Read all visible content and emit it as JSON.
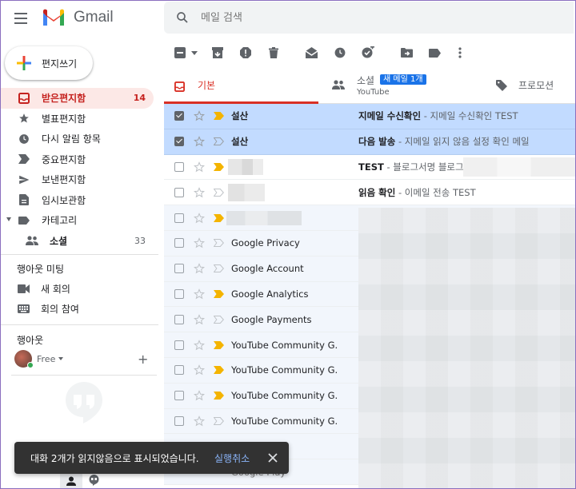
{
  "header": {
    "app_name": "Gmail",
    "search_placeholder": "메일 검색"
  },
  "compose_label": "편지쓰기",
  "nav": [
    {
      "key": "inbox",
      "label": "받은편지함",
      "count": "14",
      "icon": "inbox-icon",
      "active": true
    },
    {
      "key": "starred",
      "label": "별표편지함",
      "icon": "star-icon"
    },
    {
      "key": "snoozed",
      "label": "다시 알림 항목",
      "icon": "clock-icon"
    },
    {
      "key": "important",
      "label": "중요편지함",
      "icon": "label-important-icon"
    },
    {
      "key": "sent",
      "label": "보낸편지함",
      "icon": "send-icon"
    },
    {
      "key": "drafts",
      "label": "임시보관함",
      "icon": "draft-icon"
    },
    {
      "key": "categories",
      "label": "카테고리",
      "icon": "label-icon"
    },
    {
      "key": "social",
      "label": "소셜",
      "count": "33",
      "icon": "people-icon"
    }
  ],
  "meet": {
    "title": "행아웃 미팅",
    "new_meeting": "새 회의",
    "join_meeting": "회의 참여"
  },
  "hangouts": {
    "title": "행아웃",
    "status": "Free"
  },
  "tabs": {
    "primary": "기본",
    "social": "소셜",
    "social_badge": "새 메일 1개",
    "social_sub": "YouTube",
    "promotions": "프로모션"
  },
  "emails": [
    {
      "sender": "설산",
      "subject": "지메일 수신확인",
      "preview": " - 지메일 수신확인 TEST",
      "selected": true,
      "important": true
    },
    {
      "sender": "설산",
      "subject": "다음 발송",
      "preview": " - 지메일 읽지 않음 설정 확인 메일",
      "selected": true,
      "important": false
    },
    {
      "sender": "",
      "subject": "TEST",
      "preview": " - 블로그서명 블로그",
      "important": true,
      "unread": true
    },
    {
      "sender": "",
      "subject": "읽음 확인",
      "preview": " - 이메일 전송 TEST",
      "important": false,
      "unread": true
    },
    {
      "sender": "",
      "subject": "",
      "preview": "",
      "important": true
    },
    {
      "sender": "Google Privacy",
      "subject": "",
      "preview": "",
      "important": false
    },
    {
      "sender": "Google Account",
      "subject": "",
      "preview": "",
      "important": false
    },
    {
      "sender": "Google Analytics",
      "subject": "",
      "preview": "",
      "important": true
    },
    {
      "sender": "Google Payments",
      "subject": "",
      "preview": "",
      "important": false
    },
    {
      "sender": "YouTube Community G.",
      "subject": "",
      "preview": "",
      "important": true
    },
    {
      "sender": "YouTube Community G.",
      "subject": "",
      "preview": "",
      "important": true
    },
    {
      "sender": "YouTube Community G.",
      "subject": "",
      "preview": "",
      "important": true
    },
    {
      "sender": "YouTube Community G.",
      "subject": "",
      "preview": "",
      "important": false
    },
    {
      "sender": "",
      "subject": "",
      "preview": "",
      "important": false
    },
    {
      "sender": "Google Play",
      "subject": "",
      "preview": "",
      "important": false
    }
  ],
  "snackbar": {
    "message": "대화 2개가 읽지않음으로 표시되었습니다.",
    "undo": "실행취소"
  },
  "colors": {
    "accent_red": "#d93025",
    "selected_row": "#c2dbff",
    "badge_blue": "#1a73e8",
    "important_yellow": "#f4b400"
  }
}
